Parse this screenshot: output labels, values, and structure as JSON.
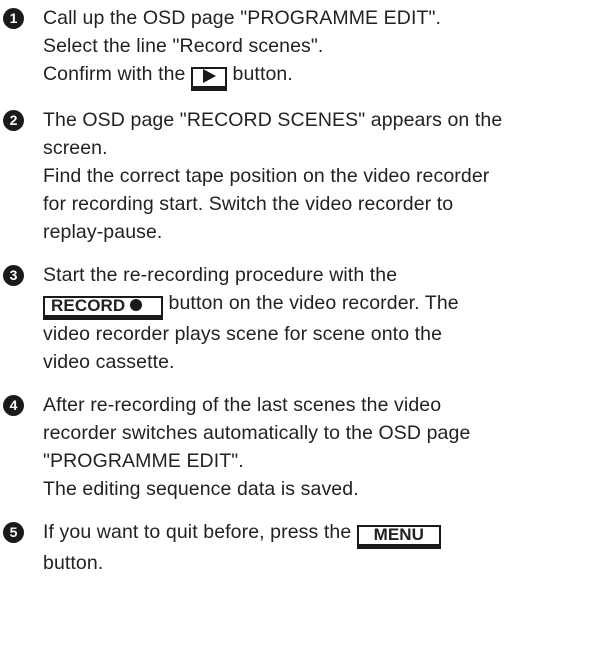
{
  "steps": [
    {
      "number": "1",
      "lines": [
        "Call up the OSD page \"PROGRAMME  EDIT\".",
        "Select the line \"Record  scenes\".",
        [
          "Confirm with the ",
          "button."
        ]
      ]
    },
    {
      "number": "2",
      "lines": [
        "The OSD page \"RECORD SCENES\" appears on the",
        "screen.",
        "Find the correct tape position on the video recorder",
        "for recording start. Switch the video recorder to",
        "replay-pause."
      ]
    },
    {
      "number": "3",
      "lines": [
        "Start the re-recording procedure with the",
        [
          "button on the video recorder. The"
        ],
        "video recorder plays scene for scene onto the",
        "video cassette."
      ]
    },
    {
      "number": "4",
      "lines": [
        "After re-recording of the last scenes the video",
        "recorder switches automatically to the OSD page",
        "\"PROGRAMME  EDIT\".",
        "The editing sequence data is saved."
      ]
    },
    {
      "number": "5",
      "lines": [
        [
          "If you want to quit before, press the "
        ],
        "button."
      ]
    }
  ],
  "buttons": {
    "play_icon": "play-triangle-icon",
    "record_label": "RECORD",
    "record_icon": "record-dot-icon",
    "menu_label": "MENU"
  }
}
